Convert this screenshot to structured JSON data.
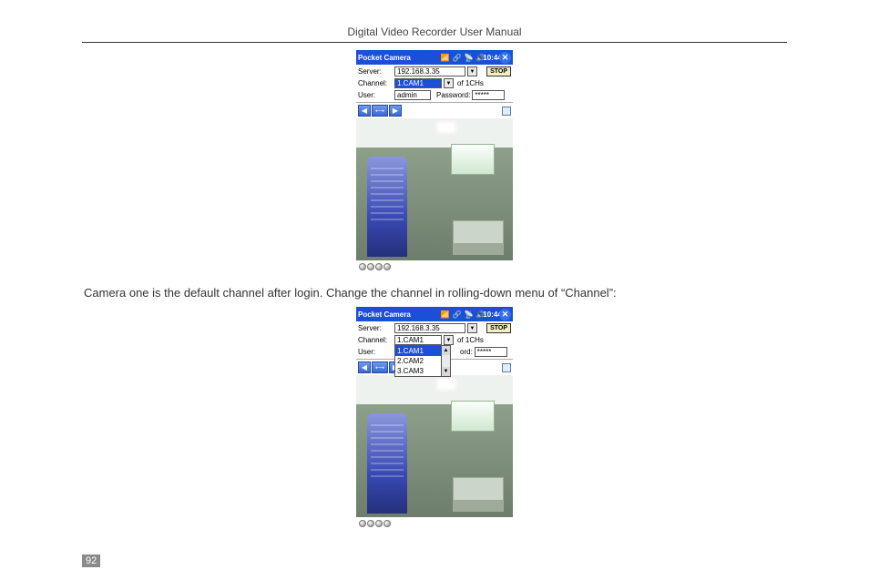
{
  "header_title": "Digital Video Recorder User Manual",
  "page_number": "92",
  "caption": "Camera one is the default channel after login. Change the channel in rolling-down menu of “Channel”:",
  "titlebar": {
    "app_name": "Pocket Camera",
    "time": "10:44"
  },
  "labels": {
    "server": "Server:",
    "channel": "Channel:",
    "user": "User:",
    "password": "Password:",
    "password_short": "ord:",
    "of_channels": "of 1CHs"
  },
  "values": {
    "server_ip": "192.168.3.35",
    "channel": "1.CAM1",
    "user": "admin",
    "password_mask": "*****"
  },
  "buttons": {
    "stop": "STOP"
  },
  "dropdown": {
    "items": [
      "1.CAM1",
      "2.CAM2",
      "3.CAM3"
    ]
  }
}
